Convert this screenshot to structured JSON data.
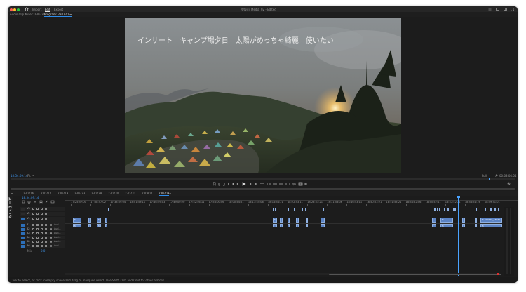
{
  "window": {
    "title": "登坂山_Media_02 - Edited",
    "traffic": {
      "close": "#fe5f57",
      "minimize": "#febc2e",
      "zoom": "#28c840"
    }
  },
  "menu": {
    "items": [
      "Import",
      "Edit",
      "Export"
    ],
    "active": "Edit"
  },
  "source": {
    "tab": "Audio Clip Mixer: 230720",
    "program_tab": "Program: 230720 ≡"
  },
  "monitor": {
    "caption": "インサート　キャンプ場夕日　太陽がめっちゃ綺麗　使いたい",
    "timecode": "18:54:09:14",
    "fit": "Fit",
    "quality": "Full",
    "duration": "00:03:04:04"
  },
  "sequence_tabs": [
    "230716",
    "230717",
    "230719",
    "230723",
    "230728",
    "230730",
    "230731",
    "230804",
    "230709"
  ],
  "active_sequence": "230709",
  "timeline": {
    "timecode": "18:54:09:14",
    "ruler": [
      "17:25:57:00",
      "17:58:57:02",
      "17:33:59:04",
      "18:01:59:11",
      "17:46:59:03",
      "17:49:00:20",
      "17:52:56:11",
      "17:58:00:06",
      "18:00:54:21",
      "18:13:54:06",
      "18:16:54:21",
      "18:22:53:11",
      "18:23:53:21",
      "18:31:53:06",
      "18:46:53:11",
      "18:50:53:21",
      "18:51:53:21",
      "18:54:52:06",
      "18:55:52:11",
      "18:57:52:21",
      "18:58:51:16",
      "18:59:51:01"
    ],
    "video_tracks": [
      "V3",
      "V2",
      "V1"
    ],
    "audio_tracks": [
      "A1",
      "A2",
      "A3",
      "A4",
      "A5",
      "A6"
    ],
    "audio_label": "Aud...",
    "mix_label": "Mix",
    "mix_value": "0.0",
    "clip_fx_label": "fx",
    "clip_label_long": "fx 230720_18551.mp4"
  },
  "status_bar": "Click to select, or click in empty space and drag to marquee select. Use Shift, Opt, and Cmd for other options.",
  "colors": {
    "accent": "#2d8ceb",
    "clip": "#5b83c4",
    "playhead": "#4aa3ff",
    "frame_bg": "#1c1c1c"
  }
}
